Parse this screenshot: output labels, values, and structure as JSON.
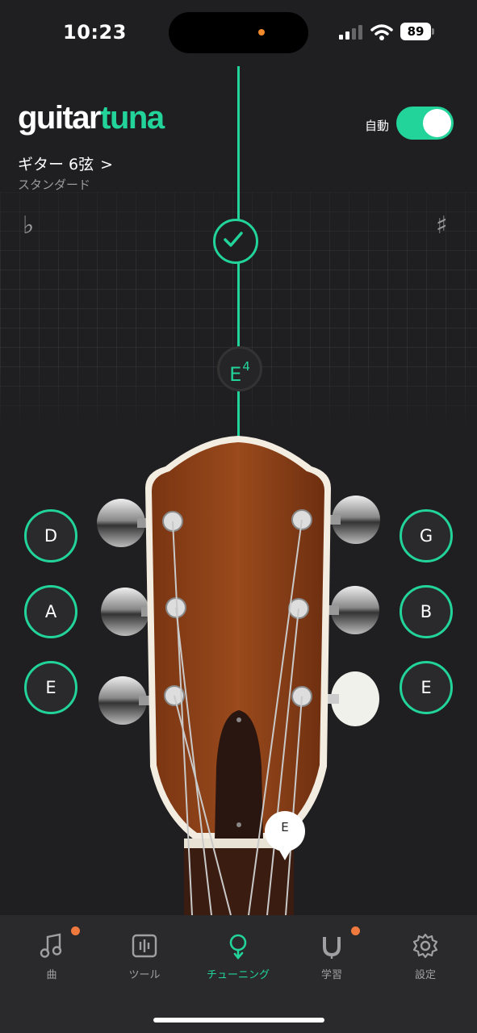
{
  "status_bar": {
    "time": "10:23",
    "battery": "89"
  },
  "app": {
    "logo_part1": "guitar",
    "logo_part2": "tuna"
  },
  "auto_toggle": {
    "label": "自動",
    "on": true
  },
  "instrument": {
    "name": "ギター 6弦",
    "chevron": ">",
    "tuning": "スタンダード"
  },
  "tuner": {
    "flat_symbol": "♭",
    "sharp_symbol": "♯",
    "current_note": "E",
    "current_octave": "4",
    "in_tune": true,
    "headstock_note": "E"
  },
  "strings": {
    "left": [
      "D",
      "A",
      "E"
    ],
    "right": [
      "G",
      "B",
      "E"
    ]
  },
  "tabs": [
    {
      "label": "曲",
      "icon": "music-note-icon",
      "badge": true
    },
    {
      "label": "ツール",
      "icon": "tools-icon",
      "badge": false
    },
    {
      "label": "チューニング",
      "icon": "tuning-fork-icon",
      "badge": false,
      "active": true
    },
    {
      "label": "学習",
      "icon": "learn-magnet-icon",
      "badge": true
    },
    {
      "label": "設定",
      "icon": "gear-icon",
      "badge": false
    }
  ],
  "colors": {
    "accent": "#22d39a",
    "badge": "#f07a3e",
    "background": "#1f1f21"
  }
}
